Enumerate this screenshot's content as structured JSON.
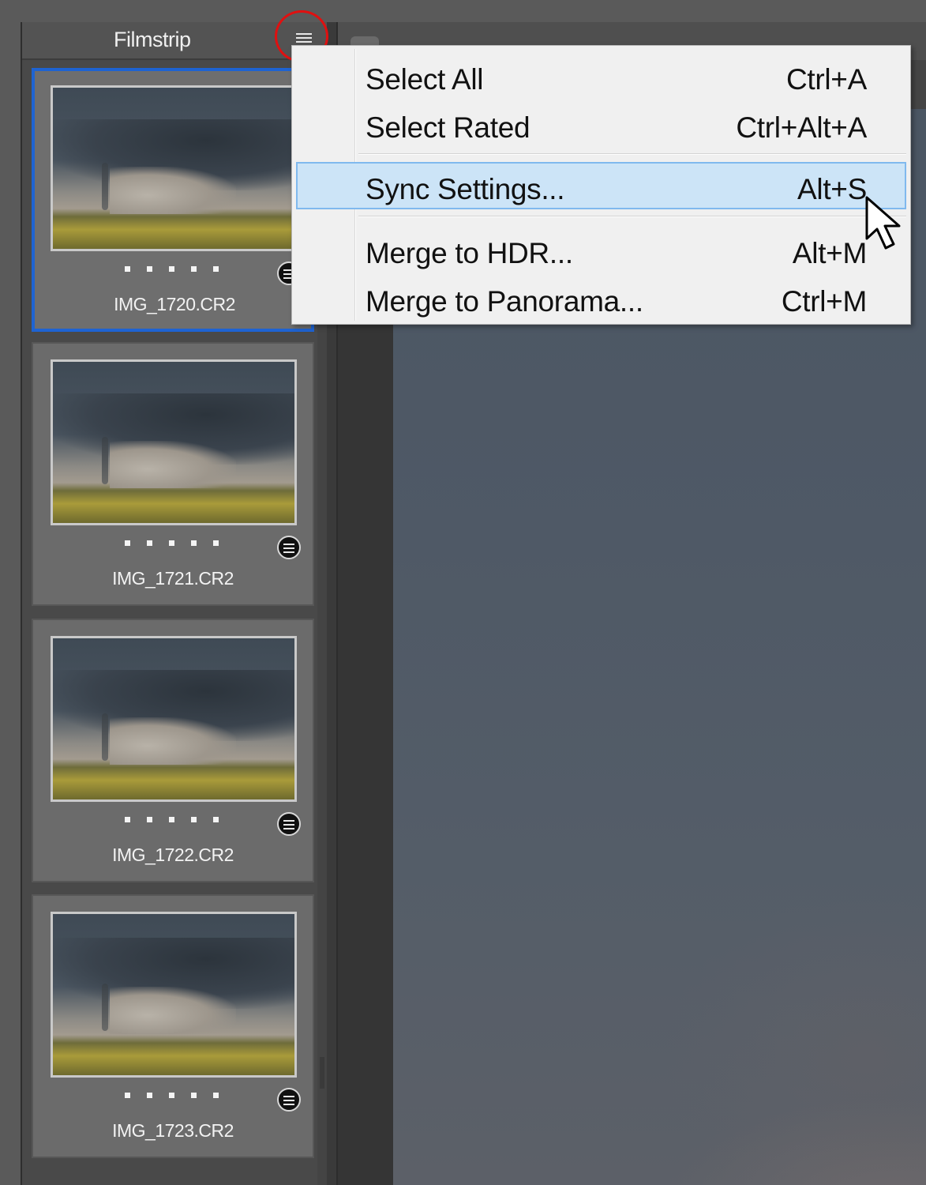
{
  "panel": {
    "title": "Filmstrip",
    "flyout_icon": "menu-lines-icon"
  },
  "filmstrip": [
    {
      "name": "IMG_1720.CR2",
      "selected": true,
      "rating_dots": 5
    },
    {
      "name": "IMG_1721.CR2",
      "selected": false,
      "rating_dots": 5
    },
    {
      "name": "IMG_1722.CR2",
      "selected": false,
      "rating_dots": 5
    },
    {
      "name": "IMG_1723.CR2",
      "selected": false,
      "rating_dots": 5
    }
  ],
  "menu": {
    "items": [
      {
        "label": "Select All",
        "shortcut": "Ctrl+A"
      },
      {
        "label": "Select Rated",
        "shortcut": "Ctrl+Alt+A"
      },
      {
        "label": "Sync Settings...",
        "shortcut": "Alt+S",
        "hover": true
      },
      {
        "label": "Merge to HDR...",
        "shortcut": "Alt+M"
      },
      {
        "label": "Merge to Panorama...",
        "shortcut": "Ctrl+M"
      }
    ]
  },
  "colors": {
    "selection_border": "#1e63d2",
    "menu_hover": "#cce4f7",
    "annotation_circle": "#e01010"
  }
}
